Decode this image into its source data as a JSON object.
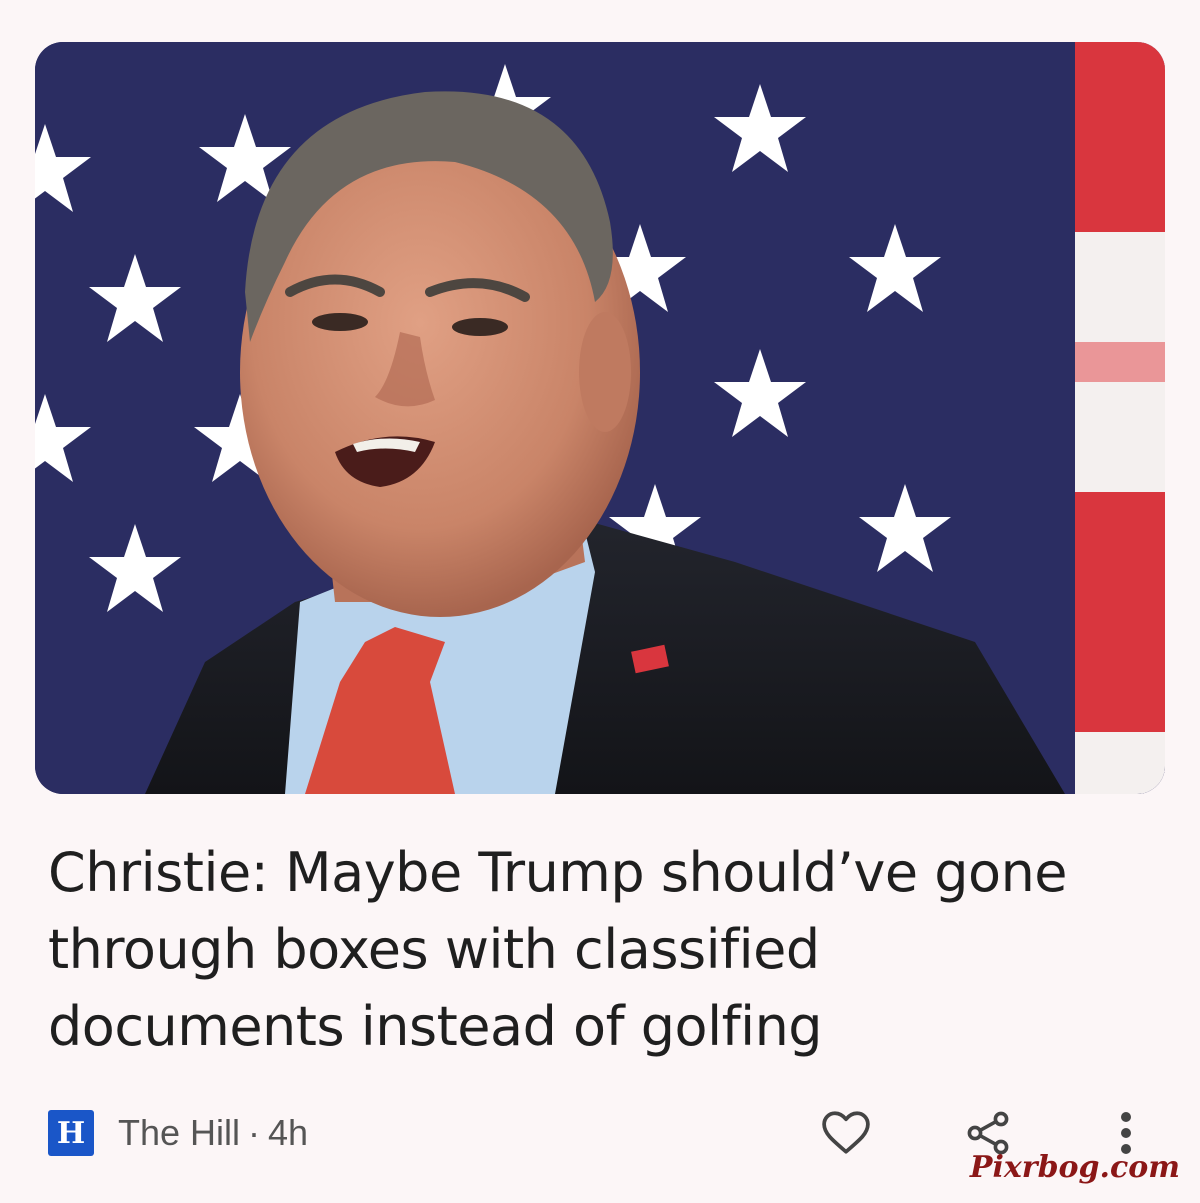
{
  "article": {
    "headline": "Christie: Maybe Trump should’ve gone through boxes with classified documents instead of golfing",
    "image_alt": "Chris Christie speaking in front of an American flag"
  },
  "source": {
    "logo_letter": "H",
    "name": "The Hill",
    "separator": "·",
    "age": "4h"
  },
  "actions": {
    "like_icon": "heart-outline-icon",
    "share_icon": "share-icon",
    "more_icon": "more-vert-icon"
  },
  "watermark": "Pixrbog.com",
  "colors": {
    "page_bg": "#fcf6f7",
    "headline": "#1f1f1f",
    "meta_text": "#555555",
    "source_logo": "#1a56c8",
    "flag_blue": "#2a2d63",
    "flag_red": "#d9363e",
    "watermark": "#8b1717"
  }
}
